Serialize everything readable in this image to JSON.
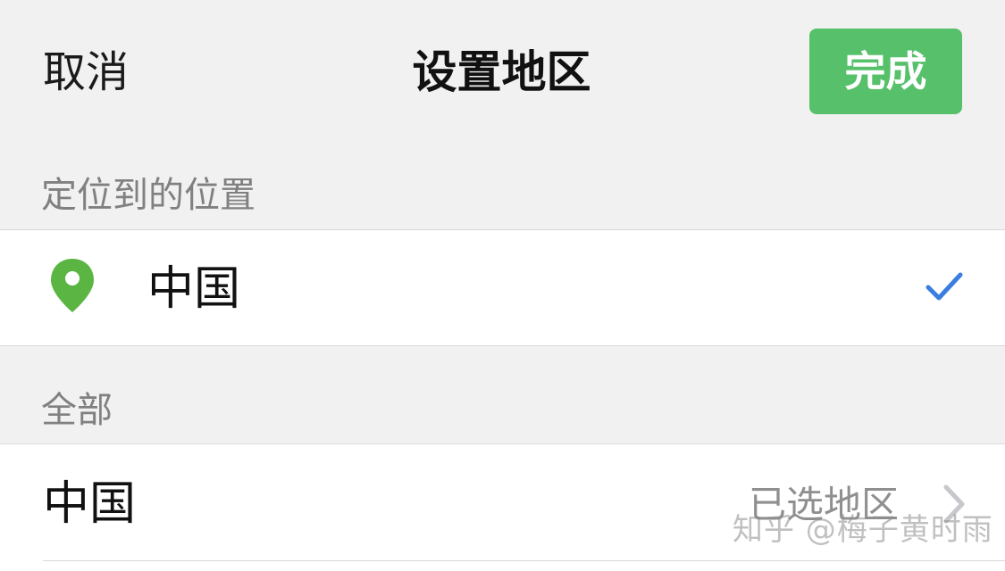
{
  "header": {
    "cancel_label": "取消",
    "title": "设置地区",
    "done_label": "完成"
  },
  "located_section": {
    "header": "定位到的位置",
    "item": {
      "icon": "location-pin-icon",
      "label": "中国",
      "selected": true,
      "check_icon": "checkmark-icon"
    }
  },
  "all_section": {
    "header": "全部",
    "items": [
      {
        "label": "中国",
        "status": "已选地区",
        "icon": "chevron-right-icon"
      }
    ]
  },
  "watermark": "知乎 @梅子黄时雨",
  "colors": {
    "done_button": "#57c06a",
    "pin": "#5bb543",
    "check": "#3a7ee0",
    "background": "#f1f1f1"
  }
}
